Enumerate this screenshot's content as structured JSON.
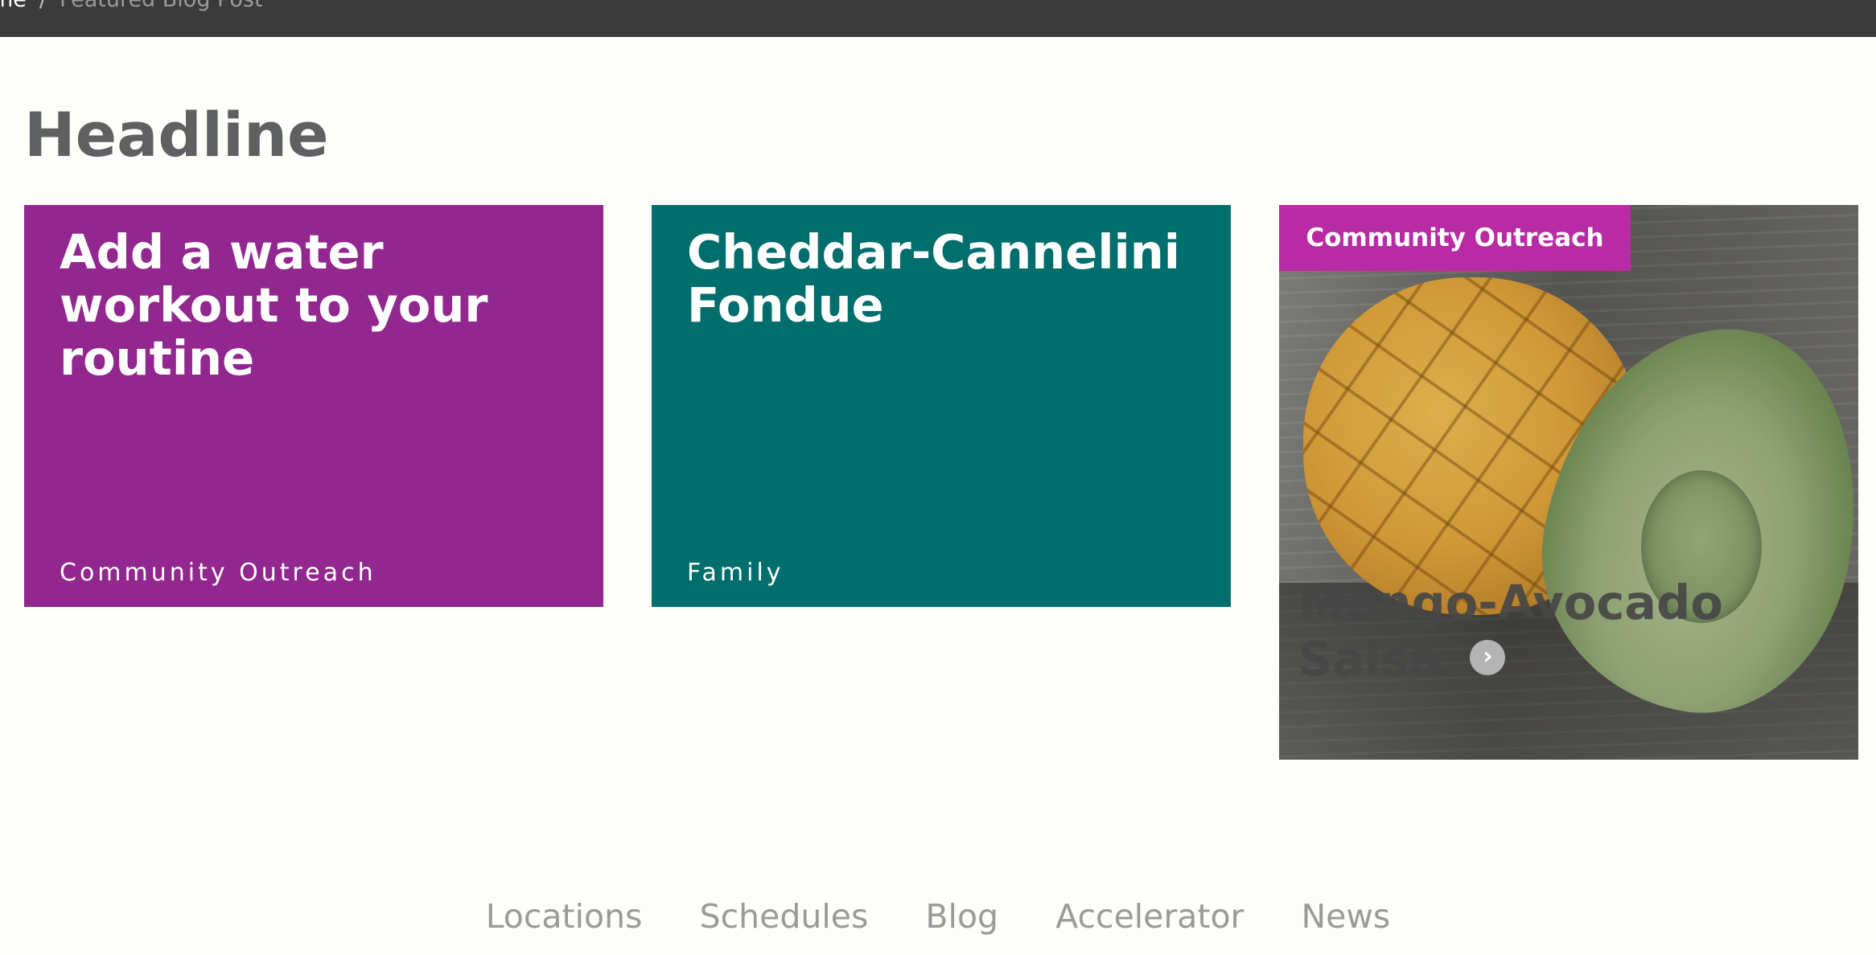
{
  "breadcrumb": {
    "home": "me",
    "separator": "/",
    "current": "Featured Blog Post"
  },
  "headline": "Headline",
  "cards": [
    {
      "title": "Add a water workout to your routine",
      "category": "Community Outreach",
      "color": "#92278f"
    },
    {
      "title": "Cheddar-Cannelini Fondue",
      "category": "Family",
      "color": "#006e6c"
    }
  ],
  "featured": {
    "badge": "Community Outreach",
    "badge_color": "#b92aa5",
    "title": "Mango-Avocado Salsa",
    "arrow_icon": "chevron-right-icon"
  },
  "footer": {
    "links": [
      "Locations",
      "Schedules",
      "Blog",
      "Accelerator",
      "News"
    ]
  }
}
